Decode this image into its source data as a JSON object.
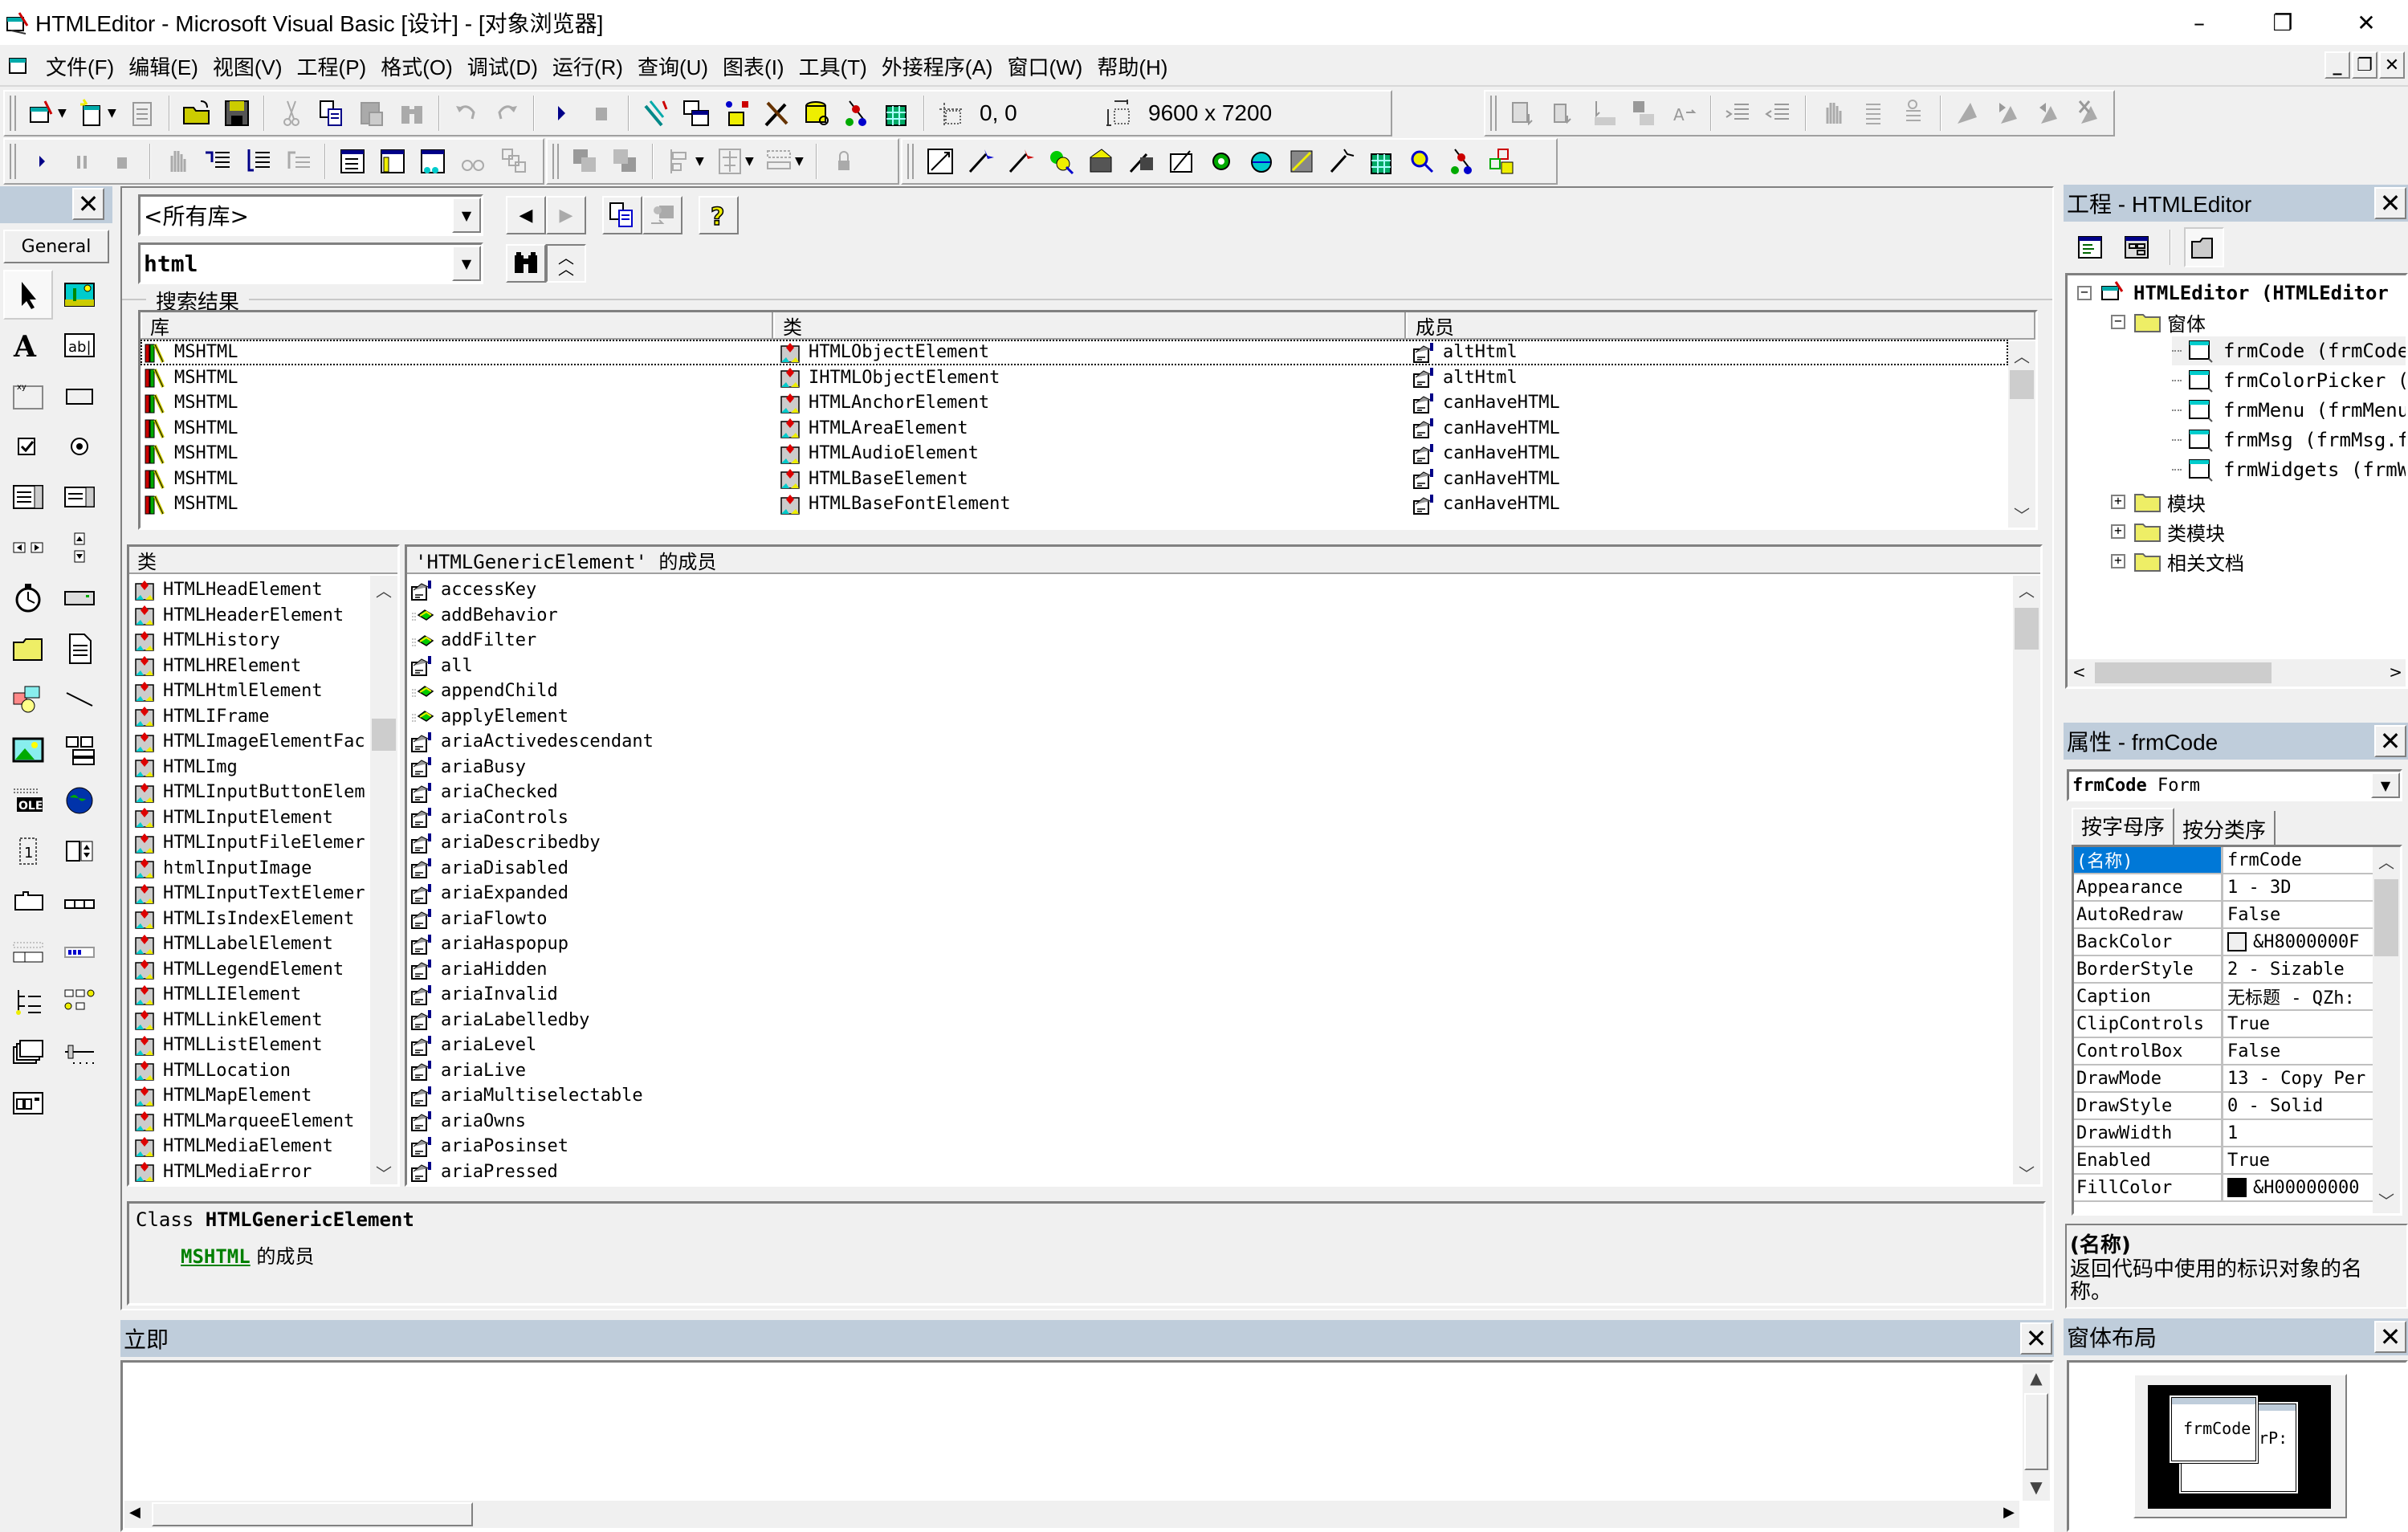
{
  "window": {
    "title": "HTMLEditor - Microsoft Visual Basic [设计] - [对象浏览器]",
    "minimize": "–",
    "restore": "❐",
    "close": "✕"
  },
  "menu": [
    "文件(F)",
    "编辑(E)",
    "视图(V)",
    "工程(P)",
    "格式(O)",
    "调试(D)",
    "运行(R)",
    "查询(U)",
    "图表(I)",
    "工具(T)",
    "外接程序(A)",
    "窗口(W)",
    "帮助(H)"
  ],
  "mdi_buttons": [
    "_",
    "❐",
    "✕"
  ],
  "toolbar": {
    "position": "0, 0",
    "size": "9600 x 7200"
  },
  "toolbox": {
    "tab": "General",
    "tools": [
      "pointer",
      "picturebox",
      "label",
      "textbox",
      "frame",
      "commandbutton",
      "checkbox",
      "optionbutton",
      "combobox",
      "listbox",
      "hscrollbar",
      "vscrollbar",
      "timer",
      "drivelistbox",
      "dirlistbox",
      "filelistbox",
      "shape",
      "line",
      "image",
      "data",
      "ole",
      "webbrowser",
      "updown",
      "spin",
      "tabstrip",
      "toolbar",
      "statusbar",
      "progressbar",
      "treeview",
      "listview",
      "imagelist",
      "slider",
      "imagecombo"
    ]
  },
  "object_browser": {
    "library": "<所有库>",
    "search": "html",
    "search_results_label": "搜索结果",
    "results_headers": [
      "库",
      "类",
      "成员"
    ],
    "results": [
      {
        "library": "MSHTML",
        "class": "HTMLObjectElement",
        "member": "altHtml"
      },
      {
        "library": "MSHTML",
        "class": "IHTMLObjectElement",
        "member": "altHtml"
      },
      {
        "library": "MSHTML",
        "class": "HTMLAnchorElement",
        "member": "canHaveHTML"
      },
      {
        "library": "MSHTML",
        "class": "HTMLAreaElement",
        "member": "canHaveHTML"
      },
      {
        "library": "MSHTML",
        "class": "HTMLAudioElement",
        "member": "canHaveHTML"
      },
      {
        "library": "MSHTML",
        "class": "HTMLBaseElement",
        "member": "canHaveHTML"
      },
      {
        "library": "MSHTML",
        "class": "HTMLBaseFontElement",
        "member": "canHaveHTML"
      }
    ],
    "classes_header": "类",
    "classes": [
      "HTMLHeadElement",
      "HTMLHeaderElement",
      "HTMLHistory",
      "HTMLHRElement",
      "HTMLHtmlElement",
      "HTMLIFrame",
      "HTMLImageElementFac",
      "HTMLImg",
      "HTMLInputButtonElem",
      "HTMLInputElement",
      "HTMLInputFileElemer",
      "htmlInputImage",
      "HTMLInputTextElemer",
      "HTMLIsIndexElement",
      "HTMLLabelElement",
      "HTMLLegendElement",
      "HTMLLIElement",
      "HTMLLinkElement",
      "HTMLListElement",
      "HTMLLocation",
      "HTMLMapElement",
      "HTMLMarqueeElement",
      "HTMLMediaElement",
      "HTMLMediaError"
    ],
    "members_header": "'HTMLGenericElement' 的成员",
    "members": [
      {
        "name": "accessKey",
        "kind": "property"
      },
      {
        "name": "addBehavior",
        "kind": "method"
      },
      {
        "name": "addFilter",
        "kind": "method"
      },
      {
        "name": "all",
        "kind": "property"
      },
      {
        "name": "appendChild",
        "kind": "method"
      },
      {
        "name": "applyElement",
        "kind": "method"
      },
      {
        "name": "ariaActivedescendant",
        "kind": "property"
      },
      {
        "name": "ariaBusy",
        "kind": "property"
      },
      {
        "name": "ariaChecked",
        "kind": "property"
      },
      {
        "name": "ariaControls",
        "kind": "property"
      },
      {
        "name": "ariaDescribedby",
        "kind": "property"
      },
      {
        "name": "ariaDisabled",
        "kind": "property"
      },
      {
        "name": "ariaExpanded",
        "kind": "property"
      },
      {
        "name": "ariaFlowto",
        "kind": "property"
      },
      {
        "name": "ariaHaspopup",
        "kind": "property"
      },
      {
        "name": "ariaHidden",
        "kind": "property"
      },
      {
        "name": "ariaInvalid",
        "kind": "property"
      },
      {
        "name": "ariaLabelledby",
        "kind": "property"
      },
      {
        "name": "ariaLevel",
        "kind": "property"
      },
      {
        "name": "ariaLive",
        "kind": "property"
      },
      {
        "name": "ariaMultiselectable",
        "kind": "property"
      },
      {
        "name": "ariaOwns",
        "kind": "property"
      },
      {
        "name": "ariaPosinset",
        "kind": "property"
      },
      {
        "name": "ariaPressed",
        "kind": "property"
      }
    ],
    "detail": {
      "prefix": "Class ",
      "name": "HTMLGenericElement",
      "library_link": "MSHTML",
      "suffix": " 的成员"
    }
  },
  "immediate": {
    "title": "立即"
  },
  "project": {
    "title": "工程 - HTMLEditor",
    "root": "HTMLEditor (HTMLEditor",
    "forms_folder": "窗体",
    "forms": [
      "frmCode (frmCode.f",
      "frmColorPicker (fr",
      "frmMenu (frmMenu.f",
      "frmMsg (frmMsg.frm",
      "frmWidgets (frmWid"
    ],
    "folders": [
      "模块",
      "类模块",
      "相关文档"
    ]
  },
  "properties": {
    "title": "属性 - frmCode",
    "object_name": "frmCode",
    "object_type": "Form",
    "tabs": [
      "按字母序",
      "按分类序"
    ],
    "rows": [
      {
        "name": "(名称)",
        "value": "frmCode"
      },
      {
        "name": "Appearance",
        "value": "1 - 3D"
      },
      {
        "name": "AutoRedraw",
        "value": "False"
      },
      {
        "name": "BackColor",
        "value": "&H8000000F",
        "swatch": "#f0f0f0"
      },
      {
        "name": "BorderStyle",
        "value": "2 - Sizable"
      },
      {
        "name": "Caption",
        "value": "无标题 - QZh:"
      },
      {
        "name": "ClipControls",
        "value": "True"
      },
      {
        "name": "ControlBox",
        "value": "False"
      },
      {
        "name": "DrawMode",
        "value": "13 - Copy Per"
      },
      {
        "name": "DrawStyle",
        "value": "0 - Solid"
      },
      {
        "name": "DrawWidth",
        "value": "1"
      },
      {
        "name": "Enabled",
        "value": "True"
      },
      {
        "name": "FillColor",
        "value": "&H00000000",
        "swatch": "#000000"
      }
    ],
    "desc_title": "(名称)",
    "desc_text": "返回代码中使用的标识对象的名称。"
  },
  "form_layout": {
    "title": "窗体布局",
    "form_front": "frmCode",
    "form_back": "orP:"
  },
  "colors": {
    "panel_title_bg": "#bfcddb",
    "selection": "#0078d7",
    "link_green": "#008000"
  }
}
